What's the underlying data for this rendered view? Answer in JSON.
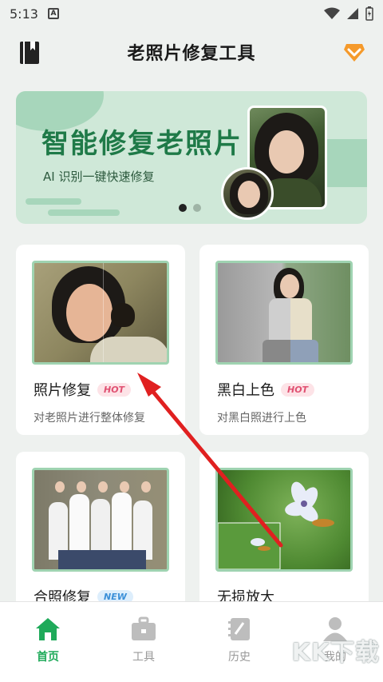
{
  "status_bar": {
    "time": "5:13",
    "notification_letter": "A"
  },
  "header": {
    "title": "老照片修复工具",
    "book_icon": "book-icon",
    "vip_icon": "diamond-icon"
  },
  "banner": {
    "title": "智能修复老照片",
    "subtitle": "AI 识别一键快速修复",
    "slide_count": 2,
    "active_slide": 1
  },
  "features": [
    {
      "name": "照片修复",
      "badge": "HOT",
      "desc": "对老照片进行整体修复"
    },
    {
      "name": "黑白上色",
      "badge": "HOT",
      "desc": "对黑白照进行上色"
    },
    {
      "name": "合照修复",
      "badge": "NEW",
      "desc": ""
    },
    {
      "name": "无损放大",
      "badge": "",
      "desc": ""
    }
  ],
  "nav": {
    "items": [
      {
        "label": "首页",
        "icon": "home-icon",
        "active": true
      },
      {
        "label": "工具",
        "icon": "toolbox-icon",
        "active": false
      },
      {
        "label": "历史",
        "icon": "history-icon",
        "active": false
      },
      {
        "label": "我的",
        "icon": "user-icon",
        "active": false
      }
    ]
  },
  "watermark": "KK下载",
  "colors": {
    "accent": "#1faa5a",
    "banner_bg": "#cfe8d8",
    "banner_title": "#1f7a48",
    "hot_badge": "#e05071",
    "new_badge": "#3a8fd8",
    "arrow": "#e02020"
  }
}
